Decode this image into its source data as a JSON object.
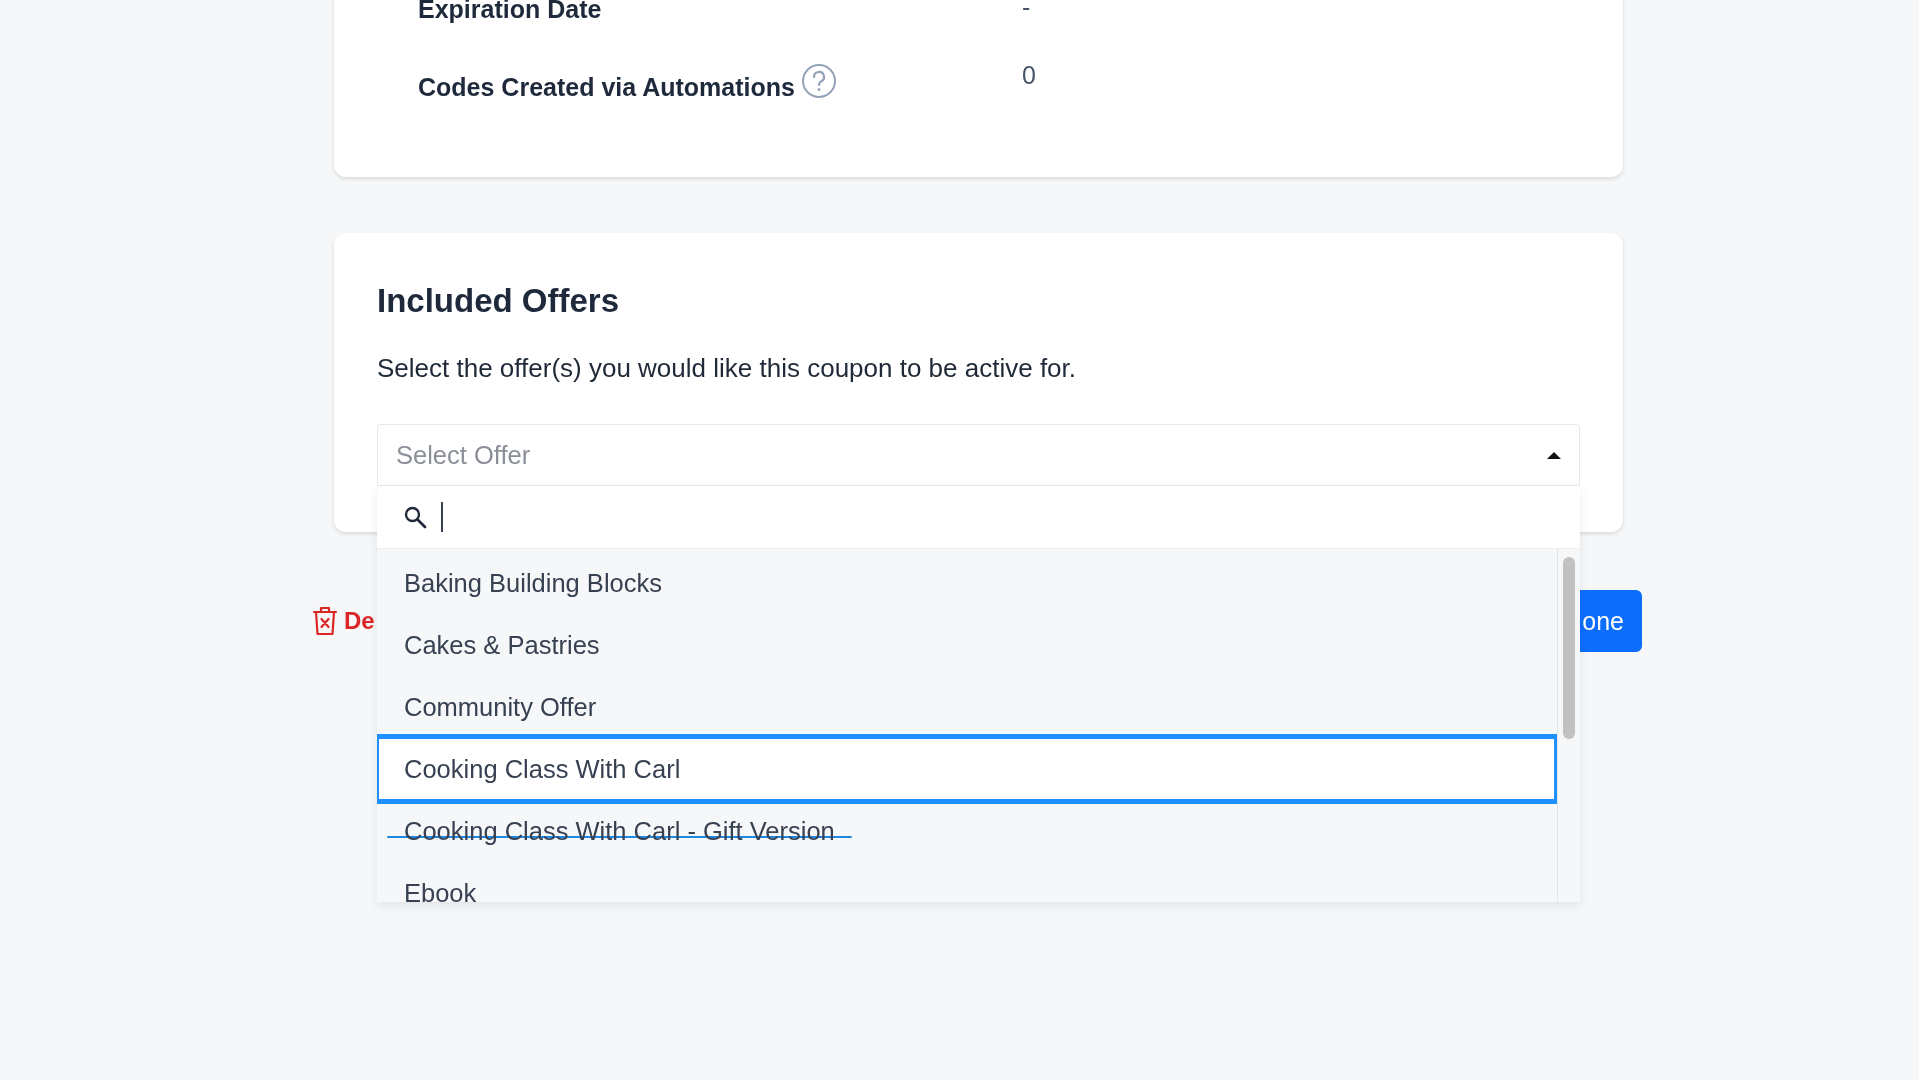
{
  "details": {
    "rows": [
      {
        "label": "Expiration Date",
        "value": "-",
        "help": false
      },
      {
        "label": "Codes Created via Automations",
        "value": "0",
        "help": true
      }
    ]
  },
  "offers": {
    "title": "Included Offers",
    "description": "Select the offer(s) you would like this coupon to be active for.",
    "select": {
      "placeholder": "Select Offer",
      "expanded": true
    },
    "items": [
      {
        "label": "Baking Building Blocks",
        "selected": false,
        "struck": false
      },
      {
        "label": "Cakes & Pastries",
        "selected": false,
        "struck": false
      },
      {
        "label": "Community Offer",
        "selected": false,
        "struck": false
      },
      {
        "label": "Cooking Class With Carl",
        "selected": true,
        "struck": false
      },
      {
        "label": "Cooking Class With Carl - Gift Version",
        "selected": false,
        "struck": true
      },
      {
        "label": "Ebook",
        "selected": false,
        "struck": false
      }
    ]
  },
  "actions": {
    "delete": "De",
    "done": "one"
  }
}
